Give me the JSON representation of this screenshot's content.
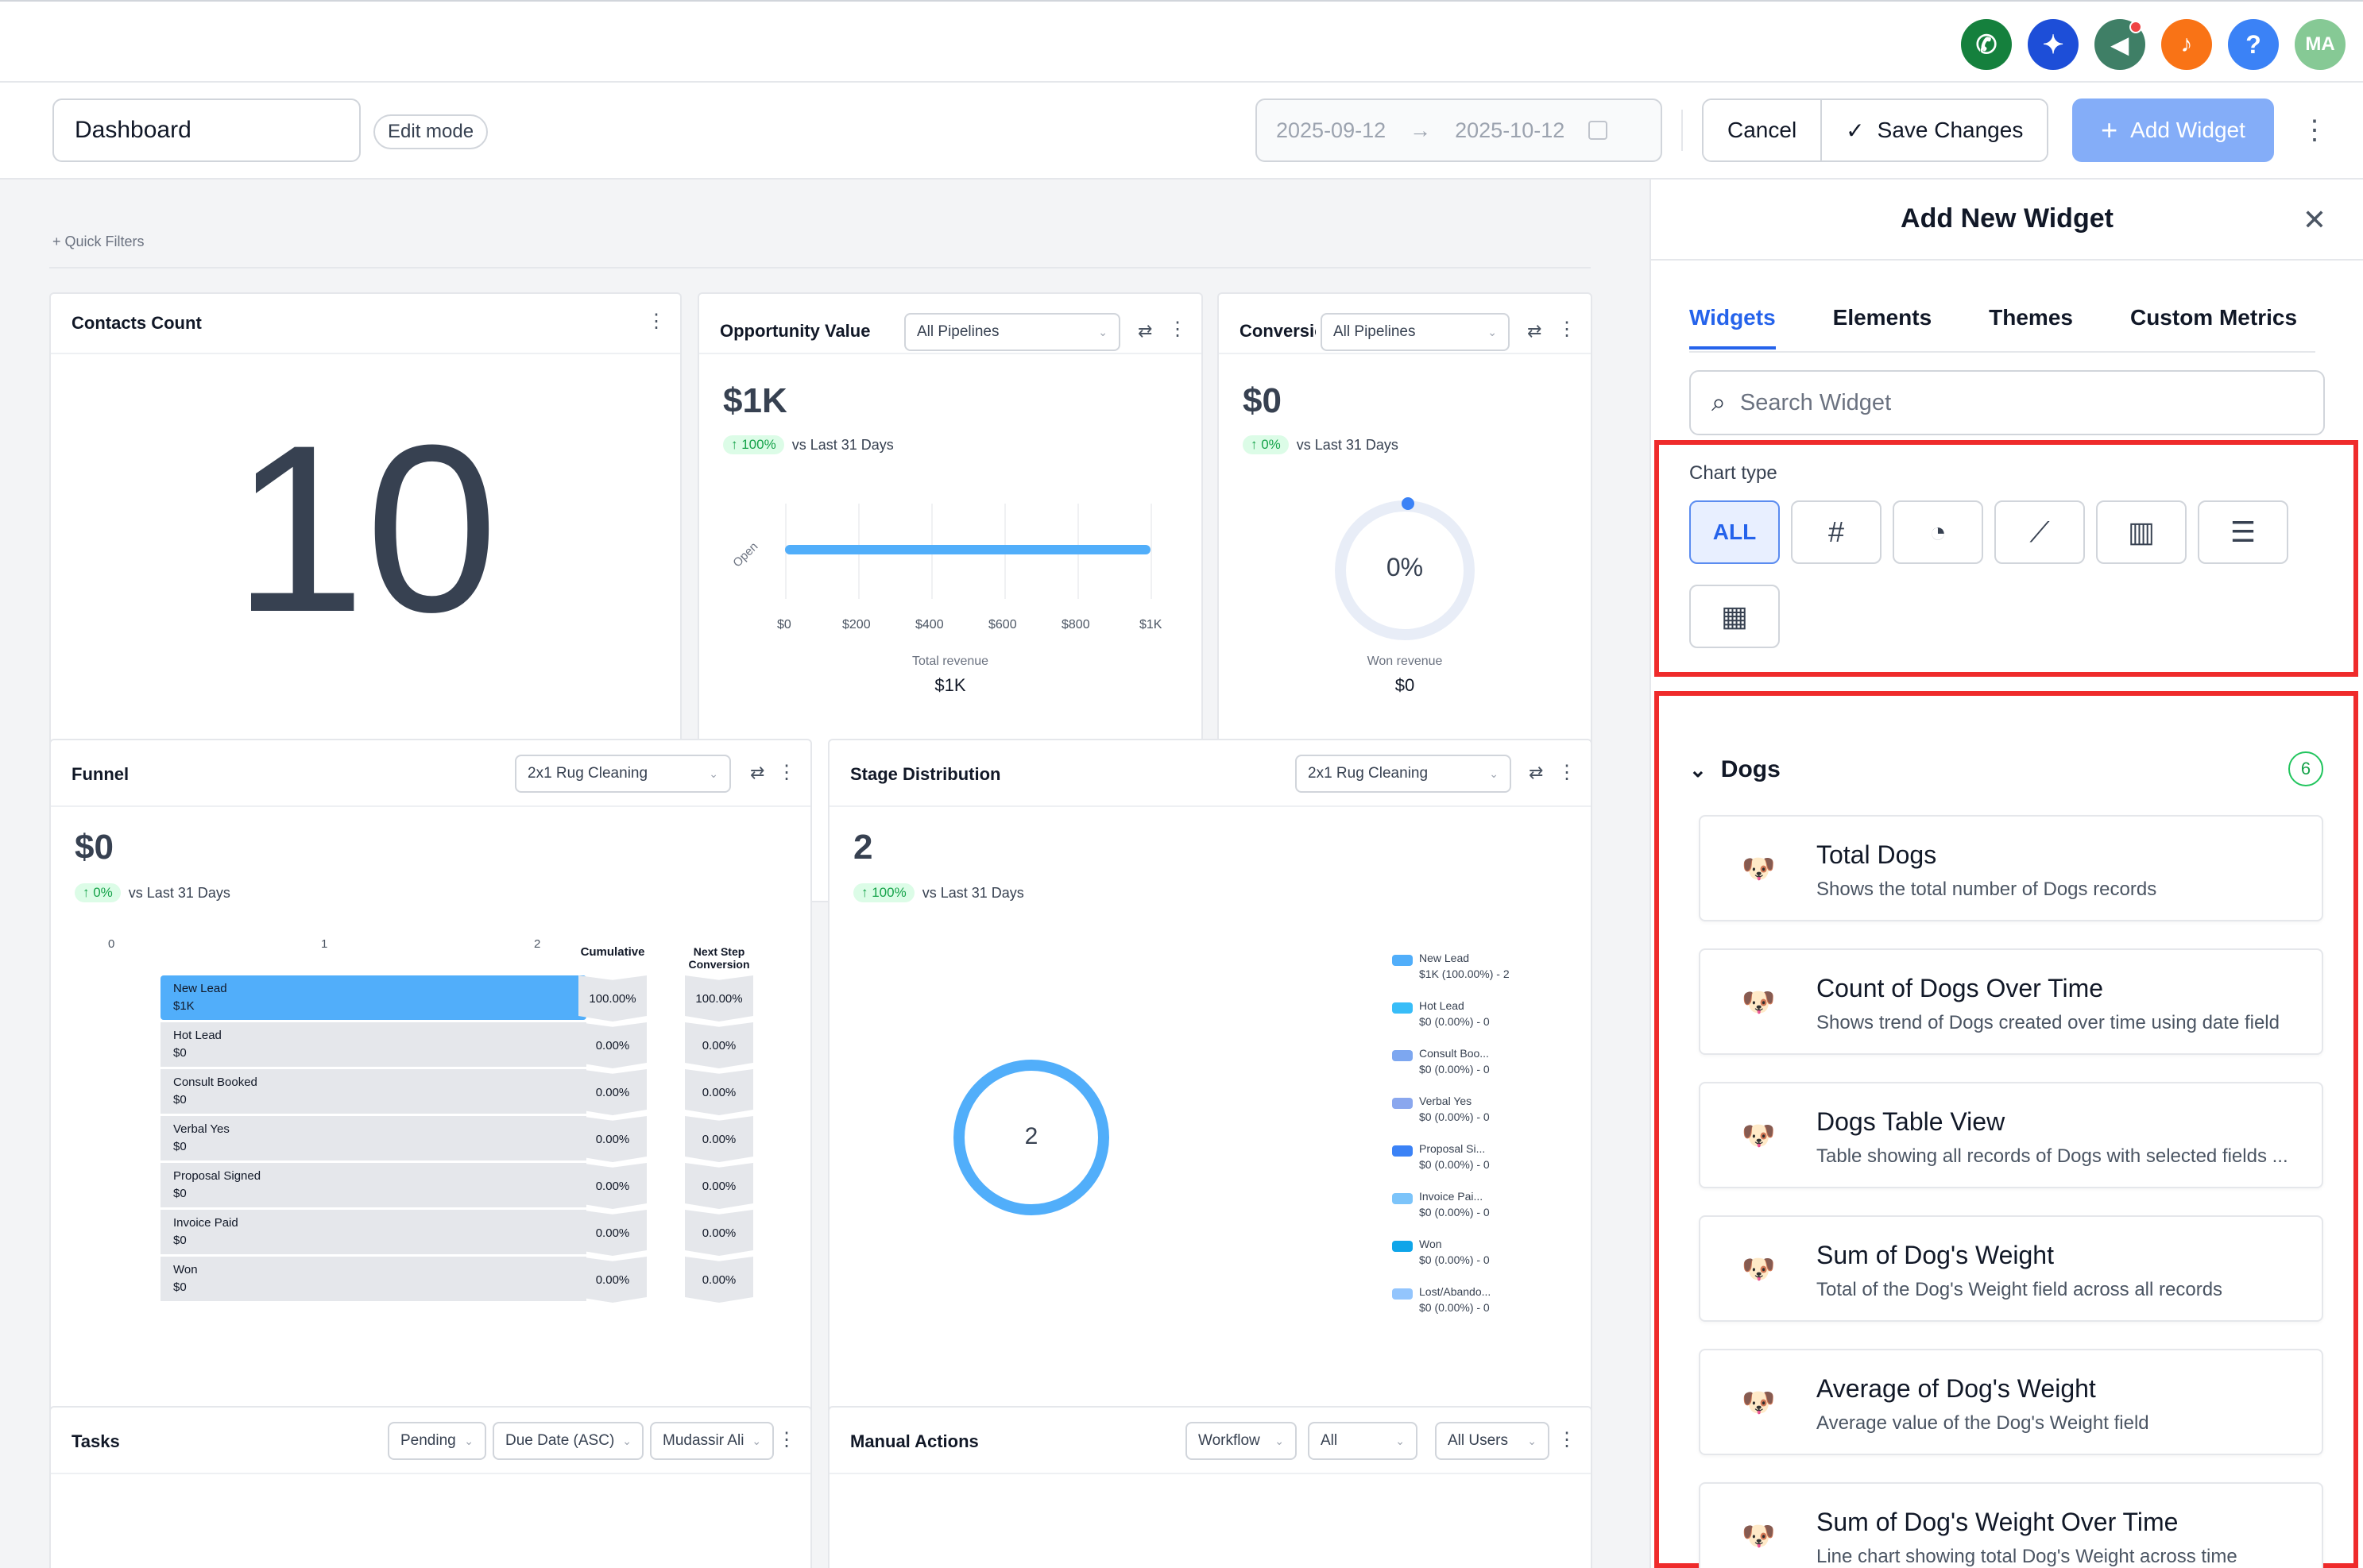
{
  "header": {
    "icons": [
      {
        "name": "phone-icon",
        "color": "#15803d",
        "glyph": "✆"
      },
      {
        "name": "sparkle-icon",
        "color": "#1d4ed8",
        "glyph": "✦"
      },
      {
        "name": "megaphone-icon",
        "color": "#3f7f66",
        "glyph": "📣"
      },
      {
        "name": "bell-icon",
        "color": "#f97316",
        "glyph": "🔔"
      },
      {
        "name": "help-icon",
        "color": "#3b82f6",
        "glyph": "?"
      },
      {
        "name": "avatar",
        "color": "#86c995",
        "glyph": "MA"
      }
    ]
  },
  "toolbar": {
    "dashboard_name": "Dashboard",
    "edit_mode_label": "Edit mode",
    "date_start": "2025-09-12",
    "date_arrow": "→",
    "date_end": "2025-10-12",
    "cancel_label": "Cancel",
    "save_label": "Save Changes",
    "add_widget_label": "Add Widget"
  },
  "canvas": {
    "quick_filters": "+ Quick Filters",
    "contacts": {
      "title": "Contacts Count",
      "value": "10"
    },
    "opportunity": {
      "title": "Opportunity Value",
      "pipeline": "All Pipelines",
      "value": "$1K",
      "delta": "↑ 100%",
      "delta_text": "vs Last 31 Days",
      "row_label": "Open",
      "x_ticks": [
        "$0",
        "$200",
        "$400",
        "$600",
        "$800",
        "$1K"
      ],
      "footer_label": "Total revenue",
      "footer_value": "$1K"
    },
    "conversion": {
      "title": "Conversion",
      "pipeline": "All Pipelines",
      "value": "$0",
      "delta": "↑ 0%",
      "delta_text": "vs Last 31 Days",
      "gauge": "0%",
      "footer_label": "Won revenue",
      "footer_value": "$0"
    },
    "funnel": {
      "title": "Funnel",
      "pipeline": "2x1 Rug Cleaning",
      "value": "$0",
      "delta": "↑ 0%",
      "delta_text": "vs Last 31 Days",
      "axis": [
        "0",
        "1",
        "2"
      ],
      "col1": "Cumulative",
      "col2_a": "Next Step",
      "col2_b": "Conversion",
      "stages": [
        {
          "name": "New Lead",
          "value": "$1K",
          "cum": "100.00%",
          "next": "100.00%"
        },
        {
          "name": "Hot Lead",
          "value": "$0",
          "cum": "0.00%",
          "next": "0.00%"
        },
        {
          "name": "Consult Booked",
          "value": "$0",
          "cum": "0.00%",
          "next": "0.00%"
        },
        {
          "name": "Verbal Yes",
          "value": "$0",
          "cum": "0.00%",
          "next": "0.00%"
        },
        {
          "name": "Proposal Signed",
          "value": "$0",
          "cum": "0.00%",
          "next": "0.00%"
        },
        {
          "name": "Invoice Paid",
          "value": "$0",
          "cum": "0.00%",
          "next": "0.00%"
        },
        {
          "name": "Won",
          "value": "$0",
          "cum": "0.00%",
          "next": "0.00%"
        }
      ]
    },
    "stage_dist": {
      "title": "Stage Distribution",
      "pipeline": "2x1 Rug Cleaning",
      "value": "2",
      "delta": "↑ 100%",
      "delta_text": "vs Last 31 Days",
      "donut": "2",
      "legend": [
        {
          "a": "New Lead",
          "b": "$1K (100.00%) - 2",
          "color": "#51aefa"
        },
        {
          "a": "Hot Lead",
          "b": "$0 (0.00%) - 0",
          "color": "#38bdf8"
        },
        {
          "a": "Consult Boo...",
          "b": "$0 (0.00%) - 0",
          "color": "#7da7f0"
        },
        {
          "a": "Verbal Yes",
          "b": "$0 (0.00%) - 0",
          "color": "#8aa7ee"
        },
        {
          "a": "Proposal Si...",
          "b": "$0 (0.00%) - 0",
          "color": "#3b82f6"
        },
        {
          "a": "Invoice Pai...",
          "b": "$0 (0.00%) - 0",
          "color": "#7cc4fa"
        },
        {
          "a": "Won",
          "b": "$0 (0.00%) - 0",
          "color": "#0ea5e9"
        },
        {
          "a": "Lost/Abando...",
          "b": "$0 (0.00%) - 0",
          "color": "#93c5fd"
        }
      ]
    },
    "tasks": {
      "title": "Tasks",
      "f1": "Pending",
      "f2": "Due Date (ASC)",
      "f3": "Mudassir Ali"
    },
    "manual": {
      "title": "Manual Actions",
      "f1": "Workflow",
      "f2": "All",
      "f3": "All Users"
    }
  },
  "panel": {
    "title": "Add New Widget",
    "tabs": [
      "Widgets",
      "Elements",
      "Themes",
      "Custom Metrics"
    ],
    "search_placeholder": "Search Widget",
    "chart_type_label": "Chart type",
    "chart_types": [
      {
        "name": "all",
        "label": "ALL"
      },
      {
        "name": "number",
        "label": "#"
      },
      {
        "name": "pie",
        "label": "◔"
      },
      {
        "name": "line",
        "label": "⟋"
      },
      {
        "name": "bar",
        "label": "▥"
      },
      {
        "name": "hbar",
        "label": "☰"
      },
      {
        "name": "table",
        "label": "▦"
      }
    ],
    "group_name": "Dogs",
    "group_count": "6",
    "widgets": [
      {
        "title": "Total Dogs",
        "desc": "Shows the total number of Dogs records"
      },
      {
        "title": "Count of Dogs Over Time",
        "desc": "Shows trend of Dogs created over time using date field"
      },
      {
        "title": "Dogs Table View",
        "desc": "Table showing all records of Dogs with selected fields ..."
      },
      {
        "title": "Sum of Dog's Weight",
        "desc": "Total of the Dog's Weight field across all records"
      },
      {
        "title": "Average of Dog's Weight",
        "desc": "Average value of the Dog's Weight field"
      },
      {
        "title": "Sum of Dog's Weight Over Time",
        "desc": "Line chart showing total Dog's Weight across time"
      }
    ]
  }
}
